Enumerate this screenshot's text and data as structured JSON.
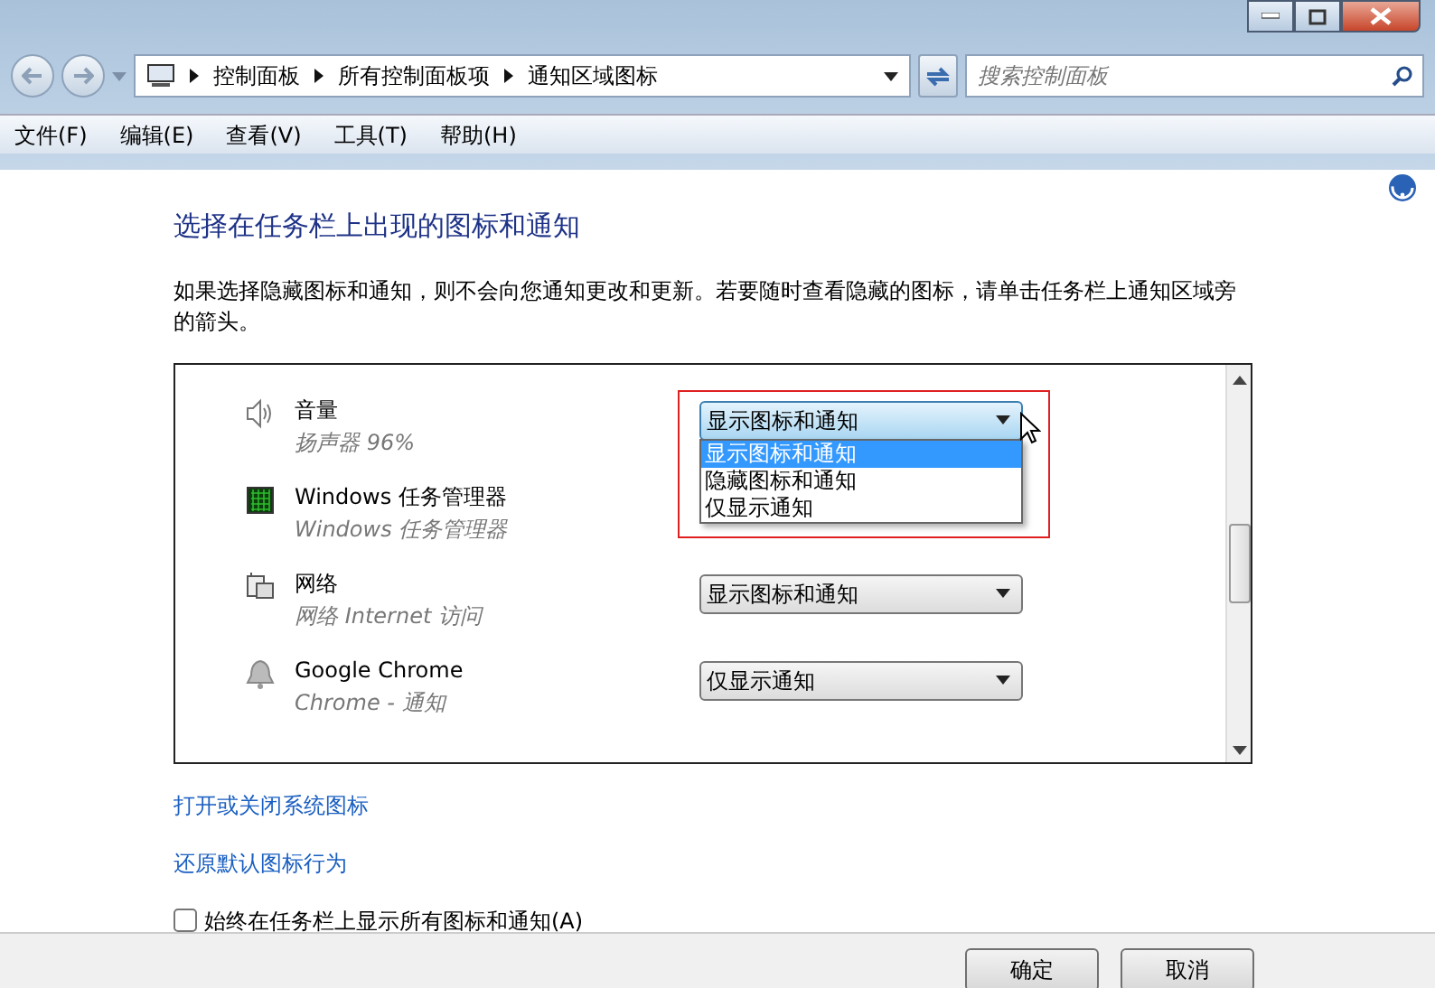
{
  "address": {
    "path": [
      "控制面板",
      "所有控制面板项",
      "通知区域图标"
    ]
  },
  "search": {
    "placeholder": "搜索控制面板"
  },
  "menu": [
    "文件(F)",
    "编辑(E)",
    "查看(V)",
    "工具(T)",
    "帮助(H)"
  ],
  "heading": "选择在任务栏上出现的图标和通知",
  "description": "如果选择隐藏图标和通知，则不会向您通知更改和更新。若要随时查看隐藏的图标，请单击任务栏上通知区域旁的箭头。",
  "items": [
    {
      "kind": "speaker",
      "name": "音量",
      "subtitle": "扬声器 96%",
      "value": "显示图标和通知",
      "expanded": true,
      "options": [
        {
          "label": "显示图标和通知",
          "selected": true
        },
        {
          "label": "隐藏图标和通知",
          "selected": false
        },
        {
          "label": "仅显示通知",
          "selected": false
        }
      ]
    },
    {
      "kind": "taskmgr",
      "name": "Windows 任务管理器",
      "subtitle": "Windows 任务管理器"
    },
    {
      "kind": "network",
      "name": "网络",
      "subtitle": "网络 Internet 访问",
      "value": "显示图标和通知",
      "expanded": false
    },
    {
      "kind": "bell",
      "name": "Google Chrome",
      "subtitle": "Chrome - 通知",
      "value": "仅显示通知",
      "expanded": false
    }
  ],
  "links": [
    "打开或关闭系统图标",
    "还原默认图标行为"
  ],
  "always_show": {
    "label": "始终在任务栏上显示所有图标和通知(A)",
    "checked": false
  },
  "buttons": [
    "确定",
    "取消"
  ]
}
